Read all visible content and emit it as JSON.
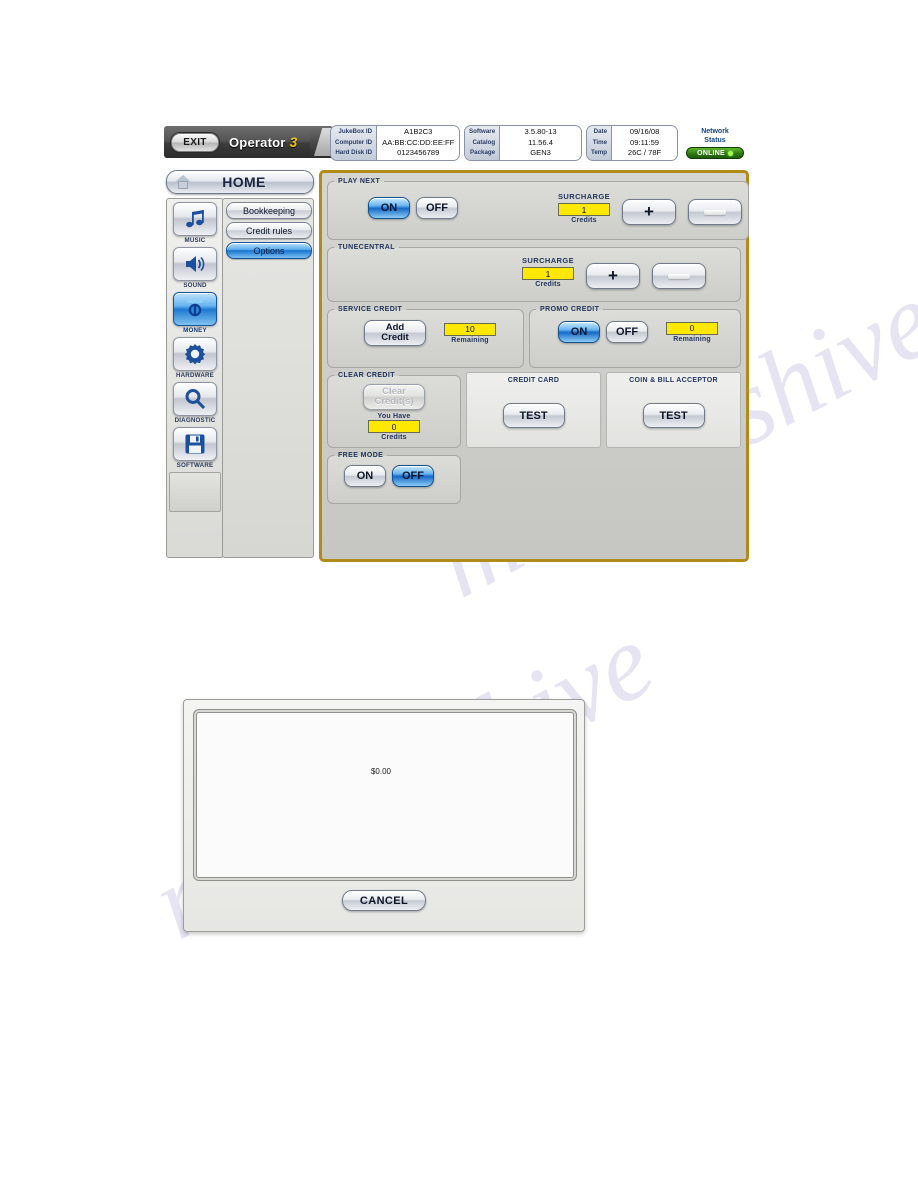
{
  "watermark": {
    "line1": "manualshive.com",
    "line2": "manualshive"
  },
  "header": {
    "exit_label": "EXIT",
    "operator_label": "Operator",
    "operator_badge": "3",
    "id_box": {
      "keys": [
        "JukeBox ID",
        "Computer ID",
        "Hard Disk ID"
      ],
      "values": [
        "A1B2C3",
        "AA:BB:CC:DD:EE:FF",
        "0123456789"
      ]
    },
    "software_box": {
      "keys": [
        "Software",
        "Catalog",
        "Package"
      ],
      "values": [
        "3.5.80-13",
        "11.56.4",
        "GEN3"
      ]
    },
    "datetime_box": {
      "keys": [
        "Date",
        "Time",
        "Temp"
      ],
      "values": [
        "09/16/08",
        "09:11:59",
        "26C / 78F"
      ]
    },
    "network": {
      "title_line1": "Network",
      "title_line2": "Status",
      "state": "ONLINE"
    }
  },
  "sidebar": {
    "home_label": "HOME",
    "rail_items": [
      {
        "label": "MUSIC",
        "icon": "music-note-icon",
        "selected": false
      },
      {
        "label": "SOUND",
        "icon": "speaker-icon",
        "selected": false
      },
      {
        "label": "MONEY",
        "icon": "money-plug-icon",
        "selected": true
      },
      {
        "label": "HARDWARE",
        "icon": "gear-icon",
        "selected": false
      },
      {
        "label": "DIAGNOSTIC",
        "icon": "magnifier-icon",
        "selected": false
      },
      {
        "label": "SOFTWARE",
        "icon": "floppy-disk-icon",
        "selected": false
      }
    ],
    "submenu_items": [
      {
        "label": "Bookkeeping",
        "selected": false
      },
      {
        "label": "Credit rules",
        "selected": false
      },
      {
        "label": "Options",
        "selected": true
      }
    ]
  },
  "main": {
    "play_next": {
      "title": "PLAY NEXT",
      "on_label": "ON",
      "off_label": "OFF",
      "state": "ON",
      "surcharge_title": "SURCHARGE",
      "surcharge_value": "1",
      "surcharge_unit": "Credits",
      "plus_label": "+",
      "minus_label": "—"
    },
    "tunecentral": {
      "title": "TUNECENTRAL",
      "surcharge_title": "SURCHARGE",
      "surcharge_value": "1",
      "surcharge_unit": "Credits",
      "plus_label": "+",
      "minus_label": "—"
    },
    "service_credit": {
      "title": "SERVICE CREDIT",
      "add_label_line1": "Add",
      "add_label_line2": "Credit",
      "value": "10",
      "unit": "Remaining"
    },
    "promo_credit": {
      "title": "PROMO CREDIT",
      "on_label": "ON",
      "off_label": "OFF",
      "state": "ON",
      "value": "0",
      "unit": "Remaining"
    },
    "clear_credit": {
      "title": "CLEAR CREDIT",
      "button_line1": "Clear",
      "button_line2": "Credit(s)",
      "disabled": true,
      "you_have_label": "You Have",
      "value": "0",
      "unit": "Credits"
    },
    "credit_card": {
      "title": "CREDIT CARD",
      "test_label": "TEST"
    },
    "coin_bill": {
      "title": "COIN & BILL ACCEPTOR",
      "test_label": "TEST"
    },
    "free_mode": {
      "title": "FREE MODE",
      "on_label": "ON",
      "off_label": "OFF",
      "state": "OFF"
    }
  },
  "dialog": {
    "amount": "$0.00",
    "cancel_label": "CANCEL"
  },
  "colors": {
    "panel_border": "#b08b18",
    "selected_blue": "#1569c6",
    "value_yellow": "#ffe800",
    "online_green": "#2f7a12"
  }
}
